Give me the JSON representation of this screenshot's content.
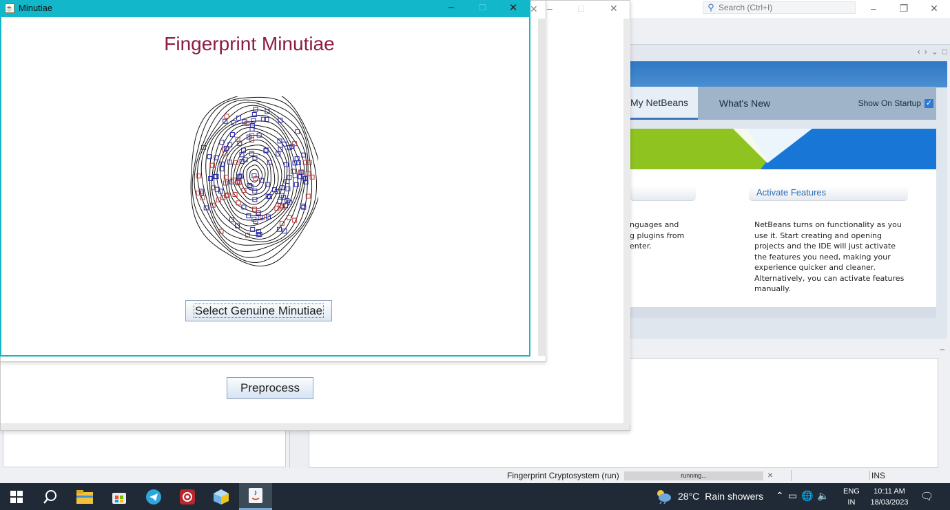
{
  "ide": {
    "search_placeholder": "Search (Ctrl+I)",
    "start_page": {
      "tabs": [
        "My NetBeans",
        "What's New"
      ],
      "show_on_startup_label": "Show On Startup",
      "show_on_startup_checked": true,
      "left_para": "nguages and\ng plugins from\nenter.",
      "activate_heading": "Activate Features",
      "activate_text": "NetBeans turns on functionality as you use it. Start creating and opening projects and the IDE will just activate the features you need, making your experience quicker and cleaner. Alternatively, you can activate features manually."
    },
    "status": {
      "run_label": "Fingerprint Cryptosystem (run)",
      "progress_text": "running...",
      "mode": "INS"
    }
  },
  "main_window": {
    "preprocess_label": "Preprocess"
  },
  "minutiae_window": {
    "title": "Minutiae",
    "heading": "Fingerprint Minutiae",
    "select_button": "Select Genuine Minutiae",
    "colors": {
      "genuine": "#2a2aa8",
      "chaff": "#c03a3a",
      "title": "#8e1a45",
      "titlebar": "#12b7c9"
    }
  },
  "taskbar": {
    "weather_temp": "28°C",
    "weather_desc": "Rain showers",
    "lang_1": "ENG",
    "lang_2": "IN",
    "time": "10:11 AM",
    "date": "18/03/2023",
    "icons": [
      "start-icon",
      "search-icon",
      "file-explorer-icon",
      "store-icon",
      "telegram-icon",
      "screen-recorder-icon",
      "virtualbox-icon",
      "java-icon"
    ]
  }
}
